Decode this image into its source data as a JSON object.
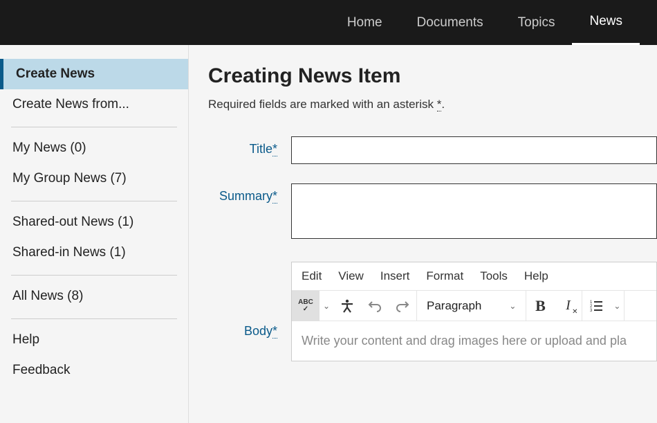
{
  "topnav": {
    "items": [
      {
        "label": "Home",
        "active": false
      },
      {
        "label": "Documents",
        "active": false
      },
      {
        "label": "Topics",
        "active": false
      },
      {
        "label": "News",
        "active": true
      }
    ]
  },
  "sidebar": {
    "group1": [
      {
        "label": "Create News",
        "active": true
      },
      {
        "label": "Create News from...",
        "active": false
      }
    ],
    "group2": [
      {
        "label": "My News (0)"
      },
      {
        "label": "My Group News (7)"
      }
    ],
    "group3": [
      {
        "label": "Shared-out News (1)"
      },
      {
        "label": "Shared-in News (1)"
      }
    ],
    "group4": [
      {
        "label": "All News (8)"
      }
    ],
    "group5": [
      {
        "label": "Help"
      },
      {
        "label": "Feedback"
      }
    ]
  },
  "main": {
    "title": "Creating News Item",
    "required_prefix": "Required fields are marked with an asterisk ",
    "required_ast": "*",
    "required_suffix": ".",
    "labels": {
      "title": "Title",
      "summary": "Summary",
      "body": "Body",
      "ast": "*"
    },
    "editor": {
      "menus": [
        "Edit",
        "View",
        "Insert",
        "Format",
        "Tools",
        "Help"
      ],
      "paragraph": "Paragraph",
      "abc": "ABC",
      "placeholder": "Write your content and drag images here or upload and pla"
    }
  }
}
